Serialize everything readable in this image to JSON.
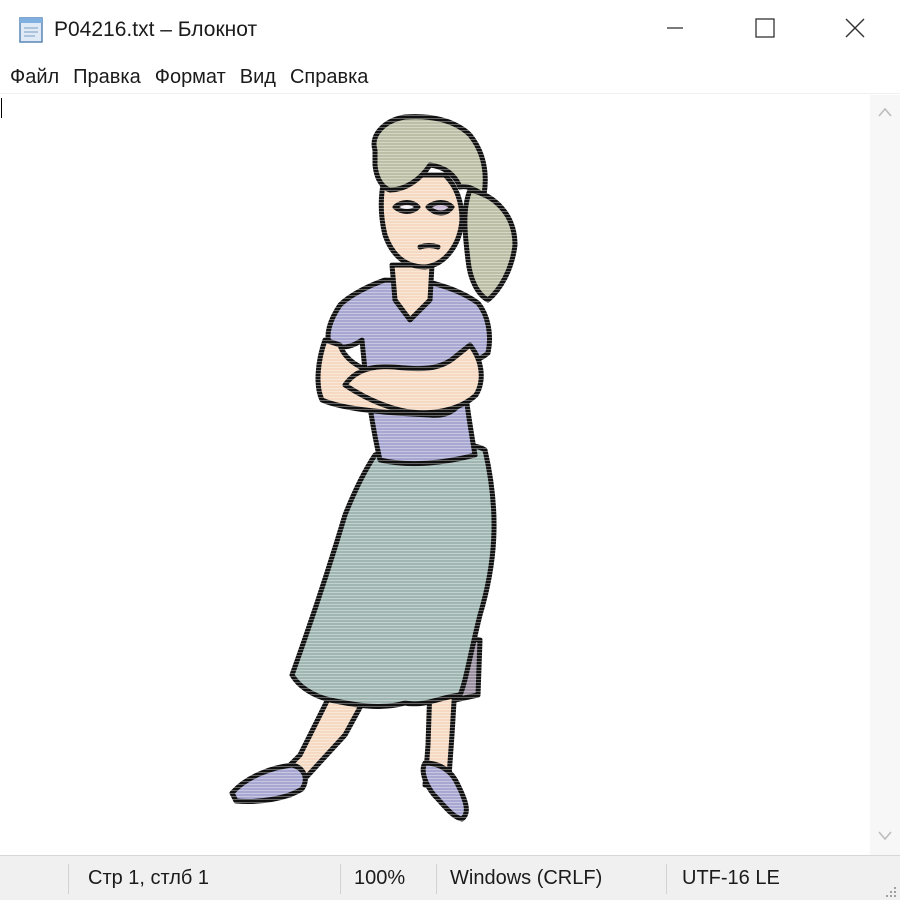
{
  "window": {
    "title": "P04216.txt – Блокнот"
  },
  "icons": {
    "app": "notepad-icon",
    "minimize": "minimize-icon",
    "maximize": "maximize-icon",
    "close": "close-icon",
    "scroll_up": "chevron-up-icon",
    "scroll_down": "chevron-down-icon",
    "grip": "resize-grip-icon"
  },
  "menu": {
    "items": [
      {
        "label": "Файл"
      },
      {
        "label": "Правка"
      },
      {
        "label": "Формат"
      },
      {
        "label": "Вид"
      },
      {
        "label": "Справка"
      }
    ]
  },
  "document": {
    "content_description": "ASCII-art style cartoon of a woman with crossed arms, grey skirt, lilac blouse"
  },
  "statusbar": {
    "position": "Стр 1, стлб 1",
    "zoom": "100%",
    "line_endings": "Windows (CRLF)",
    "encoding": "UTF-16 LE"
  },
  "colors": {
    "hair": "#bcbfa6",
    "skin": "#f6d9c2",
    "blouse": "#a7a7d2",
    "skirt": "#9fb6b3",
    "outline": "#111111"
  }
}
